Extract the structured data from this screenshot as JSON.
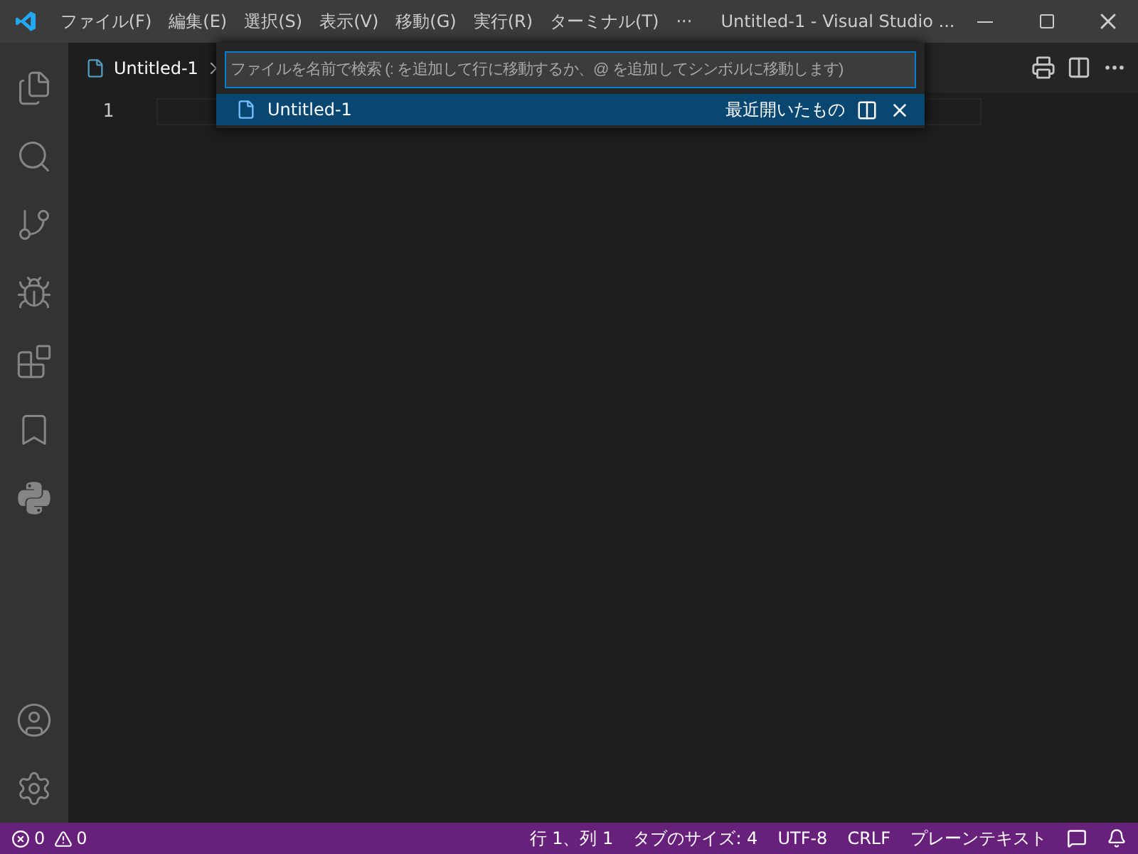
{
  "window": {
    "title": "Untitled-1 - Visual Studio ..."
  },
  "menu": [
    "ファイル(F)",
    "編集(E)",
    "選択(S)",
    "表示(V)",
    "移動(G)",
    "実行(R)",
    "ターミナル(T)",
    "···"
  ],
  "tabs": [
    {
      "label": "Untitled-1",
      "selected": true
    }
  ],
  "editor": {
    "line_numbers": [
      "1"
    ]
  },
  "quick_open": {
    "placeholder": "ファイルを名前で検索 (: を追加して行に移動するか、@ を追加してシンボルに移動します)",
    "results": [
      {
        "label": "Untitled-1",
        "detail": "最近開いたもの",
        "selected": true
      }
    ]
  },
  "status_bar": {
    "errors": "0",
    "warnings": "0",
    "items": [
      "行 1、列 1",
      "タブのサイズ: 4",
      "UTF-8",
      "CRLF",
      "プレーンテキスト"
    ]
  }
}
